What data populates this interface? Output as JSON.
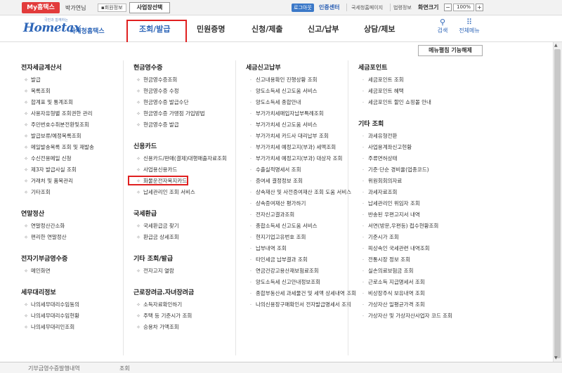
{
  "topbar": {
    "myhome": "My홈택스",
    "username": "박가연님",
    "member_info": "회원정보",
    "biz_select": "사업장선택",
    "logout": "로그아웃",
    "auth_center": "인증센터",
    "links": [
      "국세청홈페이지",
      "법령정보"
    ],
    "screen_size": "화면크기",
    "zoom": "100%",
    "zoom_minus": "−",
    "zoom_plus": "+"
  },
  "logo": {
    "tagline": "국민과 함께하는",
    "mark": "Hometax",
    "subtitle": "국세청홈택스"
  },
  "gnb": [
    "조회/발급",
    "민원증명",
    "신청/제출",
    "신고/납부",
    "상담/제보"
  ],
  "tools": {
    "search": "검색",
    "all_menu": "전체메뉴"
  },
  "menu_release": "메뉴펼침 기능해제",
  "columns": [
    {
      "groups": [
        {
          "title": "전자세금계산서",
          "items": [
            "발급",
            "목록조회",
            "합계표 및 통계조회",
            "사용자유형별 조회권한 관리",
            "주민번호수취분전환및조회",
            "발급보류/예정목록조회",
            "메일발송목록 조회 및 재발송",
            "수신전용메일 신청",
            "제3자 발급사실 조회",
            "거래처 및 품목관리",
            "기타조회"
          ]
        },
        {
          "title": "연말정산",
          "items": [
            "연말정산간소화",
            "편리한 연말정산"
          ]
        },
        {
          "title": "전자기부금영수증",
          "items": [
            "메인화면"
          ]
        },
        {
          "title": "세무대리정보",
          "items": [
            "나의세무대리수임동의",
            "나의세무대리수임현황",
            "나의세무대리인조회"
          ]
        }
      ]
    },
    {
      "groups": [
        {
          "title": "현금영수증",
          "items": [
            "현금영수증조회",
            "현금영수증 수정",
            "현금영수증 발급수단",
            "현금영수증 가맹점 가입방법",
            "현금영수증 발급"
          ]
        },
        {
          "title": "신용카드",
          "items": [
            "신용카드/판매(결제)대행매출자료조회",
            "사업용신용카드",
            "화물운전자복지카드",
            "납세관리인 조회 서비스"
          ]
        },
        {
          "title": "국세환급",
          "items": [
            "국세환급금 찾기",
            "환급금 상세조회"
          ]
        },
        {
          "title": "기타 조회/발급",
          "items": [
            "전자고지 열람"
          ]
        },
        {
          "title": "근로장려금.자녀장려금",
          "items": [
            "소득자료확인하기",
            "주택 등 기준시가 조회",
            "승용차 가액조회"
          ]
        }
      ]
    },
    {
      "groups": [
        {
          "title": "세금신고납부",
          "items": [
            "신고내용확인 진행상황 조회",
            "양도소득세 신고도움 서비스",
            "양도소득세 종합안내",
            "부가가치세매입자납부특례조회",
            "부가가치세 신고도움 서비스",
            "부가가치세 카드사 대리납부 조회",
            "부가가치세 예정고지(부과) 세액조회",
            "부가가치세 예정고지(부과) 대상자 조회",
            "수출실적명세서 조회",
            "증여세 결정정보 조회",
            "상속재산 및 사전증여재산 조회 도움 서비스",
            "상속증여재산 평가하기",
            "전자신고결과조회",
            "종합소득세 신고도움 서비스",
            "현지기업고유번호 조회",
            "납부내역 조회",
            "타인세금 납부결과 조회",
            "연금건강고용산재보험료조회",
            "양도소득세 신고안내정보조회",
            "종합부동산세 과세물건 및 세액 상세내역 조회",
            "나의신용장구매확인서 전자발급명세서 조회"
          ]
        }
      ]
    },
    {
      "groups": [
        {
          "title": "세금포인트",
          "items": [
            "세금포인트 조회",
            "세금포인트 혜택",
            "세금포인트 할인 쇼핑몰 안내"
          ]
        },
        {
          "title": "기타 조회",
          "items": [
            "과세유형전환",
            "사업용계좌신고현황",
            "주류면허상태",
            "기준·단순 경비율(업종코드)",
            "위원회회의자료",
            "과세자료조회",
            "납세관리인 위임자 조회",
            "반송된 우편고지서 내역",
            "서면(방문,우편등) 접수현황조회",
            "기준시가 조회",
            "피상속인 국세관련 내역조회",
            "전통시장 정보 조회",
            "실손의료보험금 조회",
            "근로소득 지급명세서 조회",
            "비상장주식 보유내역 조회",
            "가상자산 일평균가격 조회",
            "가상자산 및 가상자산사업자 코드 조회"
          ]
        }
      ]
    }
  ],
  "bottom": [
    "기부금영수증발행내역",
    "조회"
  ]
}
